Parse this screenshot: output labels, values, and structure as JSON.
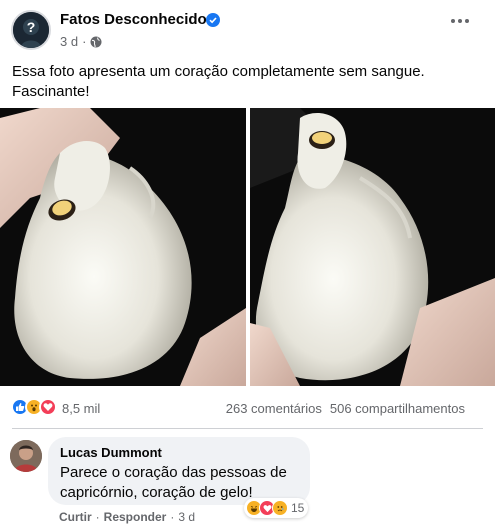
{
  "post": {
    "page_name": "Fatos Desconhecidos",
    "time": "3 d",
    "separator": "·",
    "text_line1": "Essa foto apresenta um coração completamente sem sangue.",
    "text_line2": "Fascinante!",
    "image_alt": "Coração completamente sem sangue"
  },
  "reactions": {
    "icons": [
      "like-icon",
      "wow-icon",
      "love-icon"
    ],
    "count": "8,5 mil",
    "comments": "263 comentários",
    "shares": "506 compartilhamentos"
  },
  "comment": {
    "author": "Lucas Dummont",
    "text_line1": "Parece o coração das pessoas de",
    "text_line2": "capricórnio, coração de gelo!",
    "reaction_icons": [
      "haha-icon",
      "love-icon",
      "sad-icon"
    ],
    "reaction_count": "15",
    "like_label": "Curtir",
    "reply_label": "Responder",
    "separator": "·",
    "time": "3 d"
  },
  "colors": {
    "like": "#1877f2",
    "love": "#f33e58",
    "wow": "#f7b125",
    "verified": "#1877f2"
  }
}
